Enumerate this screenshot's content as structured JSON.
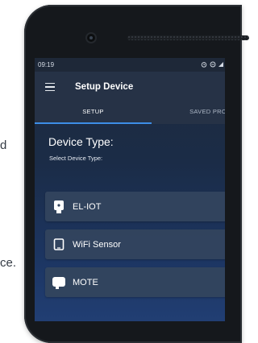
{
  "side_text": {
    "fragment_1": "d",
    "fragment_2": "ce."
  },
  "status_bar": {
    "time": "09:19"
  },
  "app_bar": {
    "title": "Setup Device"
  },
  "tabs": [
    {
      "label": "SETUP",
      "active": true
    },
    {
      "label": "SAVED PROF",
      "active": false
    }
  ],
  "device_type": {
    "title": "Device Type:",
    "subtitle": "Select Device Type:",
    "options": [
      {
        "label": "EL-IOT",
        "icon": "iot-device-icon"
      },
      {
        "label": "WiFi Sensor",
        "icon": "wifi-sensor-icon"
      },
      {
        "label": "MOTE",
        "icon": "mote-device-icon"
      }
    ]
  },
  "colors": {
    "accent": "#3d8ee6",
    "app_bar": "#263246",
    "card": "#33445e"
  }
}
